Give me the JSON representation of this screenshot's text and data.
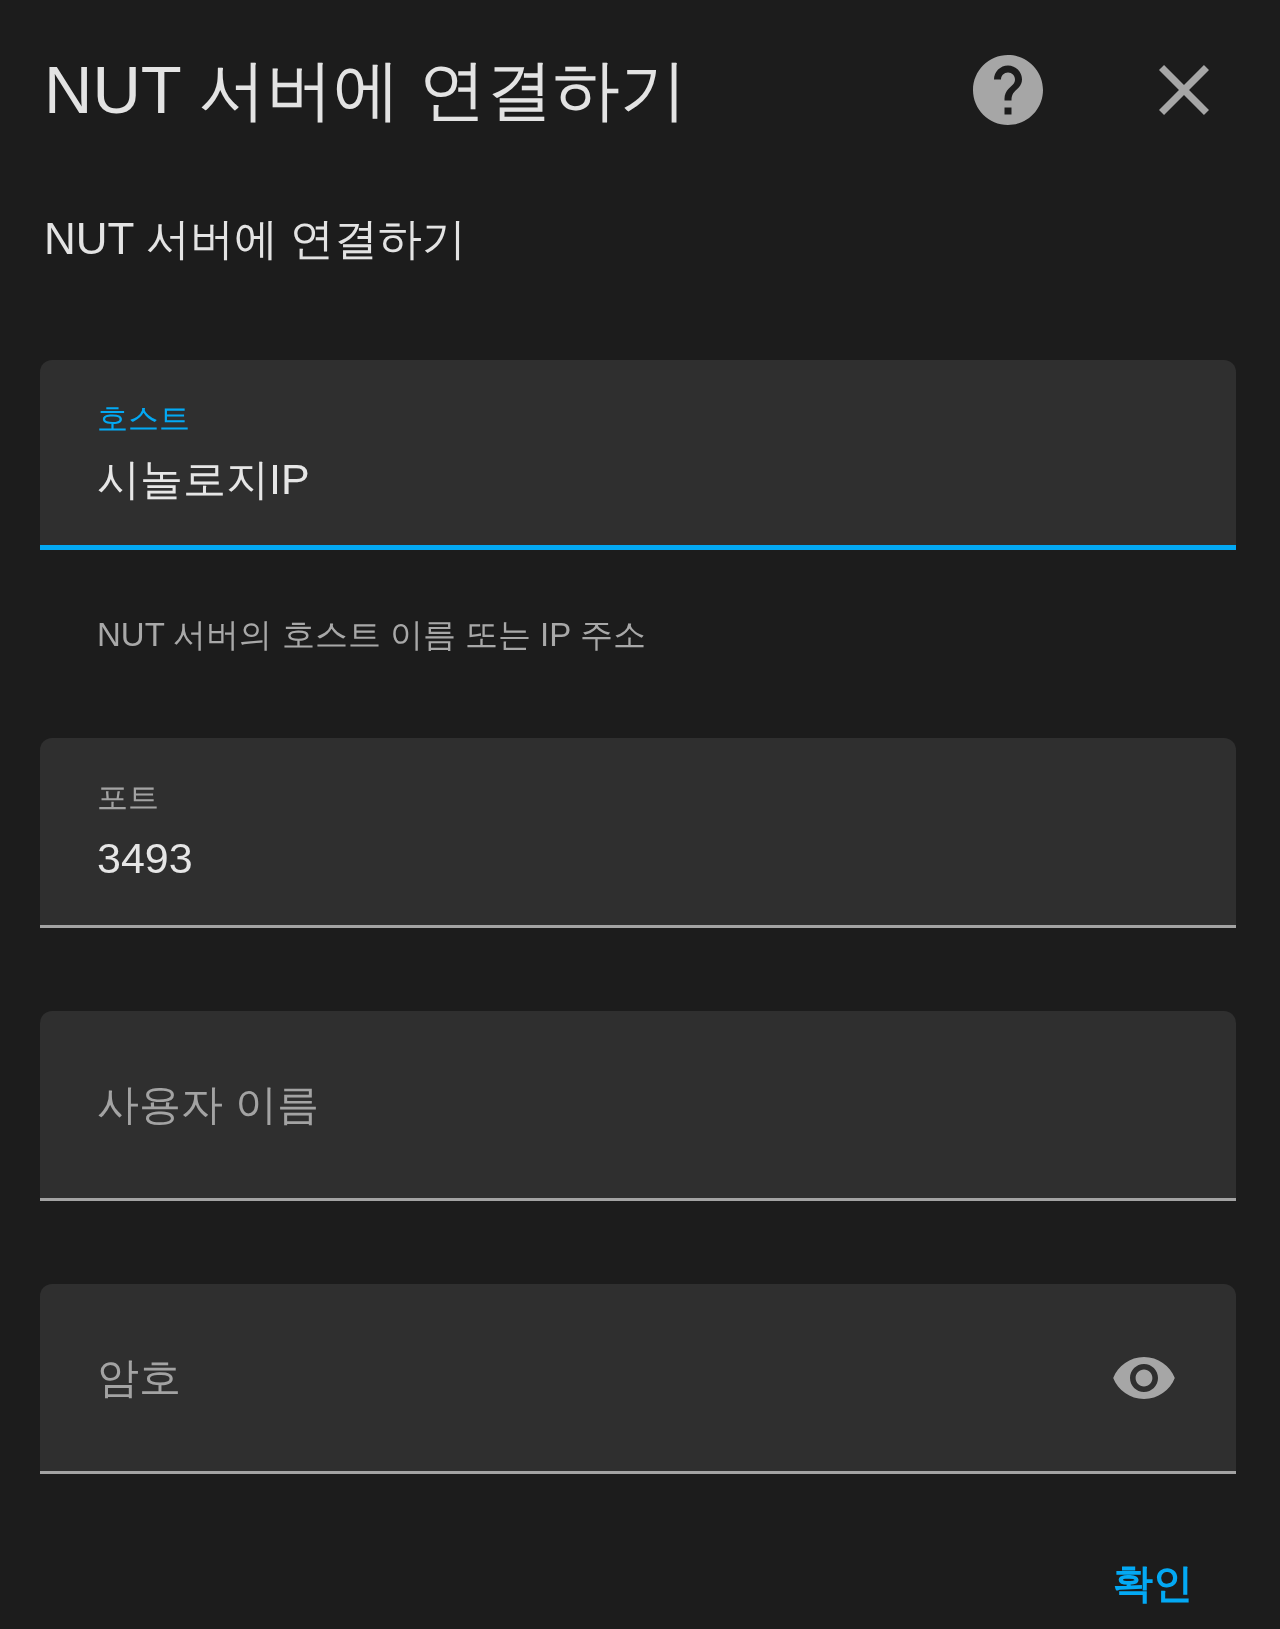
{
  "dialog": {
    "title": "NUT 서버에 연결하기",
    "description": "NUT 서버에 연결하기",
    "fields": [
      {
        "kind": "text",
        "label": "호스트",
        "value": "시놀로지IP",
        "focused": true,
        "helper": "NUT 서버의 호스트 이름 또는 IP 주소"
      },
      {
        "kind": "text",
        "label": "포트",
        "value": "3493",
        "focused": false
      },
      {
        "kind": "text",
        "label": "사용자 이름",
        "focused": false
      },
      {
        "kind": "password",
        "label": "암호",
        "focused": false
      }
    ],
    "actions": [
      "확인"
    ]
  }
}
